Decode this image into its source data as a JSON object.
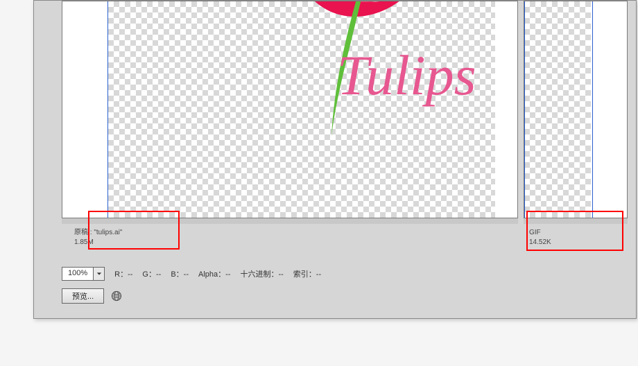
{
  "canvas": {
    "artwork_text": "Tulips"
  },
  "left_info": {
    "line1": "原稿 : \"tulips.ai\"",
    "line2": "1.85M"
  },
  "right_info": {
    "line1": "GIF",
    "line2": "14.52K"
  },
  "controls": {
    "zoom_value": "100%",
    "r_label": "R：",
    "r_value": "--",
    "g_label": "G：",
    "g_value": "--",
    "b_label": "B：",
    "b_value": "--",
    "alpha_label": "Alpha：",
    "alpha_value": "--",
    "hex_label": "十六进制：",
    "hex_value": "--",
    "index_label": "索引：",
    "index_value": "--"
  },
  "buttons": {
    "preview_label": "预览..."
  }
}
